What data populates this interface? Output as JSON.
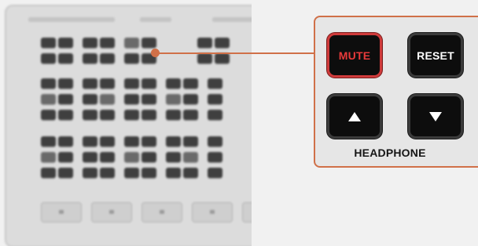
{
  "callout": {
    "buttons": {
      "mute_label": "MUTE",
      "reset_label": "RESET",
      "up_icon": "triangle-up-icon",
      "down_icon": "triangle-down-icon"
    },
    "caption": "HEADPHONE"
  },
  "colors": {
    "accent": "#d07048",
    "mute_red": "#e83a3a",
    "button_black": "#0d0d0d",
    "panel_gray": "#e6e6e6",
    "background": "#f1f1f1"
  }
}
